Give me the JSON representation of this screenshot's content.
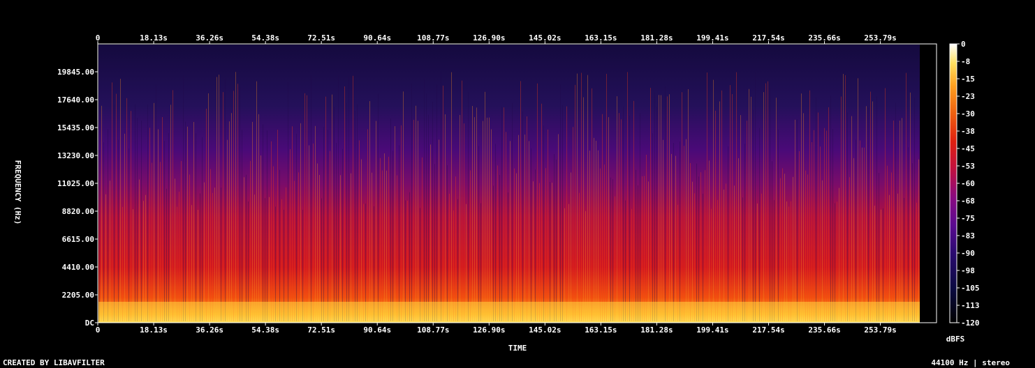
{
  "chart_data": {
    "type": "heatmap",
    "title": "",
    "xlabel": "TIME",
    "ylabel": "FREQUENCY (Hz)",
    "x_ticks": [
      "0",
      "18.13s",
      "36.26s",
      "54.38s",
      "72.51s",
      "90.64s",
      "108.77s",
      "126.90s",
      "145.02s",
      "163.15s",
      "181.28s",
      "199.41s",
      "217.54s",
      "235.66s",
      "253.79s"
    ],
    "x_tick_values": [
      0,
      18.13,
      36.26,
      54.38,
      72.51,
      90.64,
      108.77,
      126.9,
      145.02,
      163.15,
      181.28,
      199.41,
      217.54,
      235.66,
      253.79
    ],
    "xlim": [
      0,
      272
    ],
    "y_ticks": [
      "DC",
      "2205.00",
      "4410.00",
      "6615.00",
      "8820.00",
      "11025.00",
      "13230.00",
      "15435.00",
      "17640.00",
      "19845.00"
    ],
    "y_tick_values": [
      0,
      2205,
      4410,
      6615,
      8820,
      11025,
      13230,
      15435,
      17640,
      19845
    ],
    "ylim": [
      0,
      22050
    ],
    "colorbar": {
      "label": "dBFS",
      "ticks": [
        "0",
        "-8",
        "-15",
        "-23",
        "-30",
        "-38",
        "-45",
        "-53",
        "-60",
        "-68",
        "-75",
        "-83",
        "-90",
        "-98",
        "-105",
        "-113",
        "-120"
      ],
      "range": [
        -120,
        0
      ],
      "colormap": [
        "#000000",
        "#1a0a4a",
        "#3a0a7a",
        "#6a0a8a",
        "#a0106a",
        "#d01a2a",
        "#f04010",
        "#ff8010",
        "#ffc020",
        "#ffff80",
        "#ffffff"
      ]
    },
    "grid": false
  },
  "footer": {
    "credit": "CREATED BY LIBAVFILTER",
    "info": "44100 Hz | stereo"
  }
}
